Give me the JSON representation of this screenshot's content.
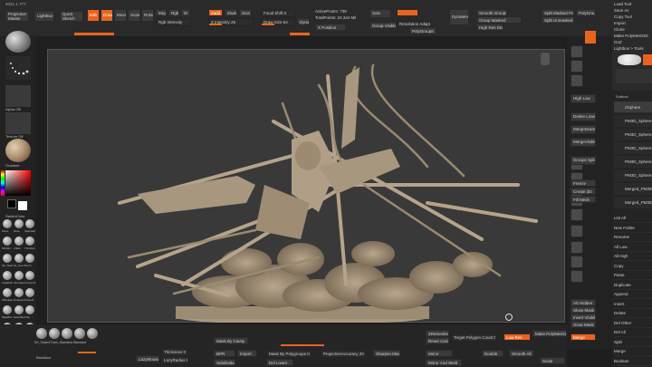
{
  "app": {
    "version": "2021.1.777",
    "projection_master": "Projection Master",
    "lightbox": "LightBox",
    "quick_sketch": "Quick Sketch"
  },
  "top_toolbar": {
    "modes": [
      "Edit",
      "Draw",
      "Move",
      "Scale",
      "Rotate"
    ],
    "mrgb": "Mrgb",
    "rgb": "Rgb",
    "m": "M",
    "zadd": "Zadd",
    "zsub": "Zsub",
    "zcut": "Zcut",
    "rgb_intensity": "Rgb Intensity",
    "z_intensity": "Z Intensity 25",
    "focal_shift": "Focal Shift 0",
    "draw_size": "Draw Size 64",
    "dynamic": "Dynamic",
    "active_points": "ActivePoints: 739",
    "total_points": "TotalPoints: 24.344 Mil",
    "x_position": "X Position",
    "solo": "Solo",
    "group_visible": "Group Visible",
    "dynamesh": "DynaMesh",
    "resolution_adaptive": "Resolution Adaptive",
    "polygroupit": "PolyGroupIt",
    "smooth_groups": "Smooth Groups",
    "group_masked": "Group Masked",
    "polygroup_masked": "PolyGroup Masked",
    "high_res": "High Res Density",
    "split_masked": "Split Masked Points",
    "split_unmasked": "Split Unmasked Points",
    "split_to_parts": "Split To Parts"
  },
  "left_panel": {
    "materials_label": "Gradient",
    "alpha_label": "Alpha Off",
    "texture_label": "Texture Off",
    "material_label": "MatCap Gray",
    "color_label": "Gradient",
    "switch_color": "SwitchColor",
    "alternate": "Alternate",
    "brushes": [
      [
        "Move",
        "Move",
        "Standard"
      ],
      [
        "hPolish",
        "Inflate",
        "TrimDynamic"
      ],
      [
        "SK_Slash",
        "SK_Gem",
        "Pinch"
      ],
      [
        "ClayBuildup",
        "DamStandard",
        "CurveTube"
      ],
      [
        "ZModeler",
        "SnakeHook",
        "Smooth"
      ],
      [
        "MaskPen",
        "SelectRect",
        "Clay"
      ],
      [
        "SK_Slash",
        "ClipCurve",
        "Clip"
      ]
    ],
    "backface": "Backface"
  },
  "right_strip": {
    "buttons": [
      "Persp",
      "Floor",
      "Local",
      "LSym",
      "Frame",
      "Move",
      "Zoom3D",
      "Rotate",
      "PolyF",
      "Transp",
      "Solo",
      "Dynamic",
      "Ghost",
      "Xpose"
    ],
    "pivot": "Pivot Mask",
    "high_low": "High Low",
    "delete_lower": "Delete Lower",
    "merge_down": "MergeDown",
    "merge_visible": "MergeVisible",
    "groups_split": "Groups Split",
    "freeze": "Freeze",
    "create_3d": "Create 3D",
    "fill_mesh": "Fill Mesh",
    "grid_labels": [
      "Art Hidden",
      "Show Mask",
      "Invert Visibility",
      "Grow Mask"
    ],
    "merge_label": "Merge"
  },
  "right_panel": {
    "header": [
      "Load Tool",
      "Save As",
      "Copy Tool",
      "Paste Tool",
      "Import",
      "Export",
      "Clone",
      "Make PolyMesh3D",
      "GoZ",
      "All",
      "Visible",
      "R"
    ],
    "lightbox_tools": "Lightbox > Tools",
    "subtool_title": "Subtool",
    "subtools": [
      "ZSphere",
      "PM3D_Sphere3D",
      "PM3D_Sphere3D_1",
      "PM3D_Sphere3D_2",
      "PM3D_Sphere3D_3",
      "PM3D_Sphere3D_4",
      "Merged_PM3D_Sphere3D",
      "Merged_PM3D_Sphere3D_5"
    ],
    "menu_items": [
      "List All",
      "New Folder",
      "Rename",
      "All Low",
      "All High",
      "Copy",
      "Paste",
      "Duplicate",
      "Append",
      "Insert",
      "Delete",
      "Del Other",
      "Del All",
      "Split",
      "Merge",
      "Boolean",
      "Remesh",
      "Project",
      "Extract",
      "Geometry",
      "ArrayMesh",
      "Stager",
      "Layers",
      "FiberMesh",
      "Geometry HD",
      "Preview",
      "Surface",
      "Deformation",
      "Masking",
      "Visibility"
    ]
  },
  "bottom_bar": {
    "presets": [
      "Dots",
      "Gray",
      "Alpha",
      "Texture"
    ],
    "brush_labels": [
      "SK_Slash3",
      "Dam_Standard",
      "Standard",
      "hPolish",
      "Move"
    ],
    "thickness": "Thickness 0",
    "lazy_mouse": "LazyMouse",
    "lazy_radius": "LazyRadius 8",
    "mask_by_cavity": "Mask By Cavity",
    "backface_mask": "BackfaceMask",
    "mask_lasso": "Mask Lasso",
    "mask_ambient": "Mask Ambient Occlusion",
    "mask_by_polygroups": "Mask By Polygroups 0",
    "sharpen_mask": "Sharpen Mask",
    "blur_mask": "Blur Mask",
    "zremesher": "ZRemesher",
    "target_count": "Target Polygon Count 5",
    "half": "Half",
    "same": "Same",
    "double": "Double",
    "adapt": "Adapt",
    "mirror": "Mirror",
    "mirror_weld": "Mirror And Weld",
    "smooth_all": "Smooth All",
    "subdivide": "Subdivide",
    "del_lower": "Del Lower",
    "freeze_borders": "Freeze Borders",
    "keep_groups": "KeepGroups",
    "auto_groups": "Auto Groups",
    "make_polymesh": "Make PolyMesh3D",
    "reset_cavity": "Reset Cavity",
    "low_res": "Low Res",
    "reconstruct": "Reconstruct Subdiv",
    "projection_accuracy": "ProjectionAccuracy 20",
    "scale": "Scale",
    "transp": "Transp",
    "persp": "Persp",
    "weld_points": "Weld Points",
    "import": "Import",
    "export": "Export",
    "project_all": "Project All",
    "dist": "Dist 0.02",
    "polish": "Polish",
    "double_btn": "Double",
    "record": "Record",
    "reset_all": "Reset All Brushes",
    "bpr": "BPR",
    "spix": "SPix 3",
    "render": "Render"
  },
  "colors": {
    "accent": "#e8641e",
    "bg": "#1e1e1e",
    "panel": "#262626",
    "canvas": "#3a3a3a",
    "model": "#a8977f"
  },
  "icons": [
    "brush-sphere-icon",
    "stroke-dots-icon",
    "alpha-icon",
    "texture-icon",
    "material-sphere-icon",
    "color-picker-icon",
    "refresh-icon",
    "lock-icon"
  ]
}
